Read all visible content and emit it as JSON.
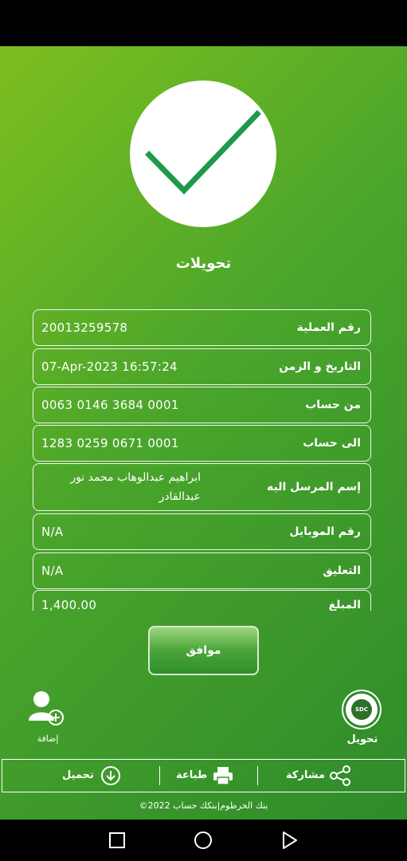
{
  "title": "تحويلات",
  "details": [
    {
      "label": "رقم العملية",
      "value": "20013259578"
    },
    {
      "label": "التاريخ و الزمن",
      "value": "07-Apr-2023 16:57:24"
    },
    {
      "label": "من حساب",
      "value": "0063 0146 3684 0001"
    },
    {
      "label": "الى حساب",
      "value": "1283 0259 0671 0001"
    },
    {
      "label": "إسم المرسل اليه",
      "value": "ابراهيم عبدالوهاب محمد نور عبدالقادر"
    },
    {
      "label": "رقم الموبايل",
      "value": "N/A"
    },
    {
      "label": "التعليق",
      "value": "N/A"
    },
    {
      "label": "المبلغ",
      "value": "1,400.00"
    }
  ],
  "ok_button": "موافق",
  "add_label": "إضافة",
  "sdc_badge": "SDC",
  "transfer_label": "تحويل",
  "actions": {
    "share": "مشاركة",
    "print": "طباعة",
    "download": "تحميل"
  },
  "footer": "©2022 بنك الخرطوم|بنكك حساب",
  "colors": {
    "gradient_start": "#7dbf1f",
    "gradient_end": "#2e8b2a",
    "check": "#1e9a4a"
  },
  "icons": {
    "success": "checkmark-icon",
    "add": "add-user-icon",
    "sdc": "sdc-logo-icon",
    "share": "share-icon",
    "print": "printer-icon",
    "download": "download-icon",
    "nav_recent": "square-icon",
    "nav_home": "circle-icon",
    "nav_back": "triangle-back-icon"
  }
}
